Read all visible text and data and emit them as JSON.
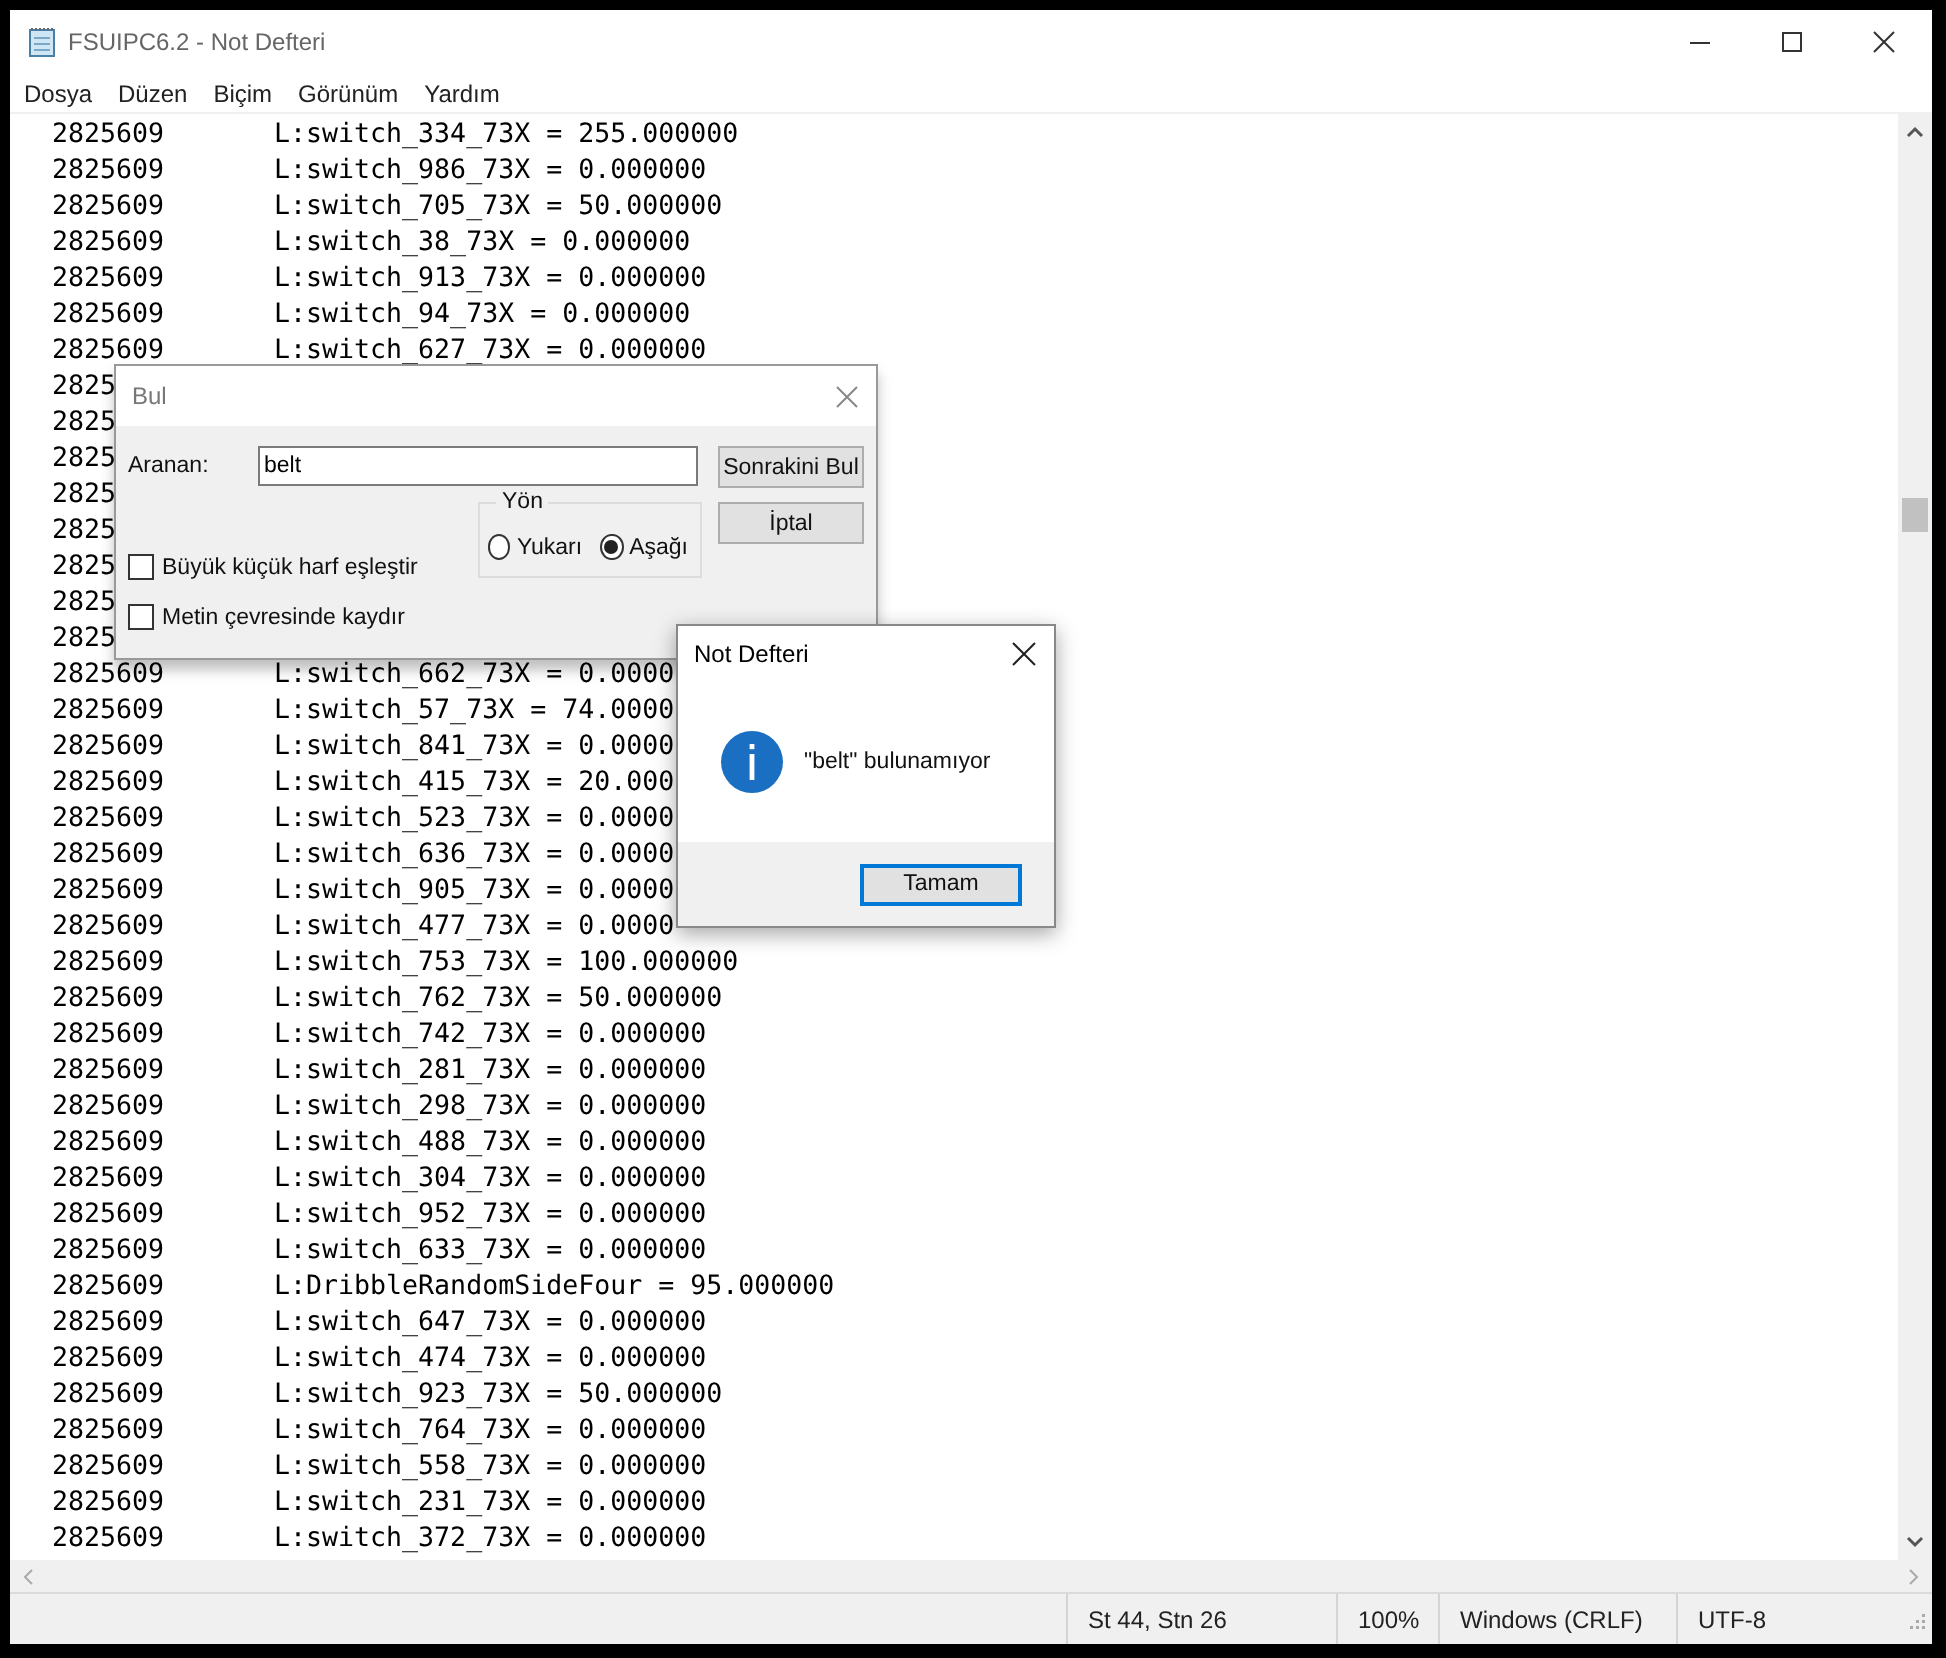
{
  "window": {
    "title": "FSUIPC6.2 - Not Defteri"
  },
  "menu": [
    "Dosya",
    "Düzen",
    "Biçim",
    "Görünüm",
    "Yardım"
  ],
  "lines": [
    {
      "number": "2825609",
      "value": "L:switch_334_73X = 255.000000"
    },
    {
      "number": "2825609",
      "value": "L:switch_986_73X = 0.000000"
    },
    {
      "number": "2825609",
      "value": "L:switch_705_73X = 50.000000"
    },
    {
      "number": "2825609",
      "value": "L:switch_38_73X = 0.000000"
    },
    {
      "number": "2825609",
      "value": "L:switch_913_73X = 0.000000"
    },
    {
      "number": "2825609",
      "value": "L:switch_94_73X = 0.000000"
    },
    {
      "number": "2825609",
      "value": "L:switch_627_73X = 0.000000"
    },
    {
      "number": "2825"
    },
    {
      "number": "2825"
    },
    {
      "number": "2825"
    },
    {
      "number": "2825"
    },
    {
      "number": "2825"
    },
    {
      "number": "2825"
    },
    {
      "number": "2825"
    },
    {
      "number": "2825"
    },
    {
      "number": "2825609",
      "value": "L:switch_662_73X = 0.0000"
    },
    {
      "number": "2825609",
      "value": "L:switch_57_73X = 74.0000"
    },
    {
      "number": "2825609",
      "value": "L:switch_841_73X = 0.0000"
    },
    {
      "number": "2825609",
      "value": "L:switch_415_73X = 20.000"
    },
    {
      "number": "2825609",
      "value": "L:switch_523_73X = 0.0000"
    },
    {
      "number": "2825609",
      "value": "L:switch_636_73X = 0.0000"
    },
    {
      "number": "2825609",
      "value": "L:switch_905_73X = 0.0000"
    },
    {
      "number": "2825609",
      "value": "L:switch_477_73X = 0.0000"
    },
    {
      "number": "2825609",
      "value": "L:switch_753_73X = 100.000000"
    },
    {
      "number": "2825609",
      "value": "L:switch_762_73X = 50.000000"
    },
    {
      "number": "2825609",
      "value": "L:switch_742_73X = 0.000000"
    },
    {
      "number": "2825609",
      "value": "L:switch_281_73X = 0.000000"
    },
    {
      "number": "2825609",
      "value": "L:switch_298_73X = 0.000000"
    },
    {
      "number": "2825609",
      "value": "L:switch_488_73X = 0.000000"
    },
    {
      "number": "2825609",
      "value": "L:switch_304_73X = 0.000000"
    },
    {
      "number": "2825609",
      "value": "L:switch_952_73X = 0.000000"
    },
    {
      "number": "2825609",
      "value": "L:switch_633_73X = 0.000000"
    },
    {
      "number": "2825609",
      "value": "L:DribbleRandomSideFour = 95.000000"
    },
    {
      "number": "2825609",
      "value": "L:switch_647_73X = 0.000000"
    },
    {
      "number": "2825609",
      "value": "L:switch_474_73X = 0.000000"
    },
    {
      "number": "2825609",
      "value": "L:switch_923_73X = 50.000000"
    },
    {
      "number": "2825609",
      "value": "L:switch_764_73X = 0.000000"
    },
    {
      "number": "2825609",
      "value": "L:switch_558_73X = 0.000000"
    },
    {
      "number": "2825609",
      "value": "L:switch_231_73X = 0.000000"
    },
    {
      "number": "2825609",
      "value": "L:switch_372_73X = 0.000000"
    }
  ],
  "find_dialog": {
    "title": "Bul",
    "search_label": "Aranan:",
    "search_value": "belt",
    "find_next_button": "Sonrakini Bul",
    "cancel_button": "İptal",
    "direction_label": "Yön",
    "directions": [
      {
        "label": "Yukarı",
        "selected": false
      },
      {
        "label": "Aşağı",
        "selected": true
      }
    ],
    "options": [
      {
        "label": "Büyük küçük harf eşleştir",
        "checked": false
      },
      {
        "label": "Metin çevresinde kaydır",
        "checked": false
      }
    ]
  },
  "message_box": {
    "title": "Not Defteri",
    "message": "\"belt\" bulunamıyor",
    "ok_button": "Tamam"
  },
  "status_bar": [
    "St 44, Stn 26",
    "100%",
    "Windows (CRLF)",
    "UTF-8"
  ]
}
